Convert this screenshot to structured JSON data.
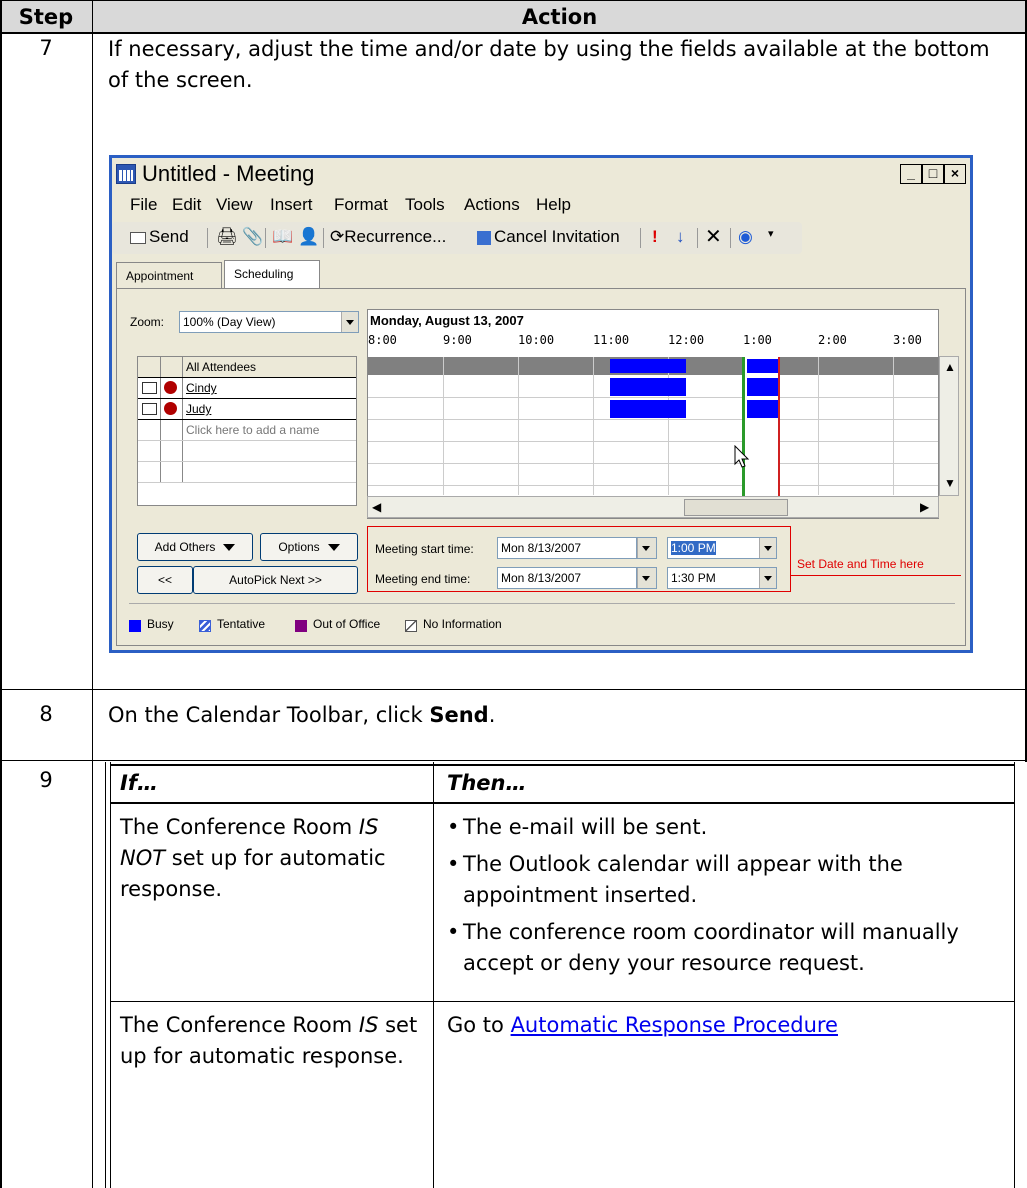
{
  "header": {
    "step": "Step",
    "action": "Action"
  },
  "step7": {
    "number": "7",
    "text": "If necessary, adjust the time and/or date by using the fields available at the bottom of the screen."
  },
  "window": {
    "title": "Untitled - Meeting",
    "controls": [
      "_",
      "□",
      "×"
    ],
    "menu": [
      "File",
      "Edit",
      "View",
      "Insert",
      "Format",
      "Tools",
      "Actions",
      "Help"
    ],
    "toolbar": {
      "send": "Send",
      "recurrence": "Recurrence...",
      "cancel_invitation": "Cancel Invitation"
    },
    "tabs": [
      "Appointment",
      "Scheduling"
    ],
    "zoom_label": "Zoom:",
    "zoom_value": "100% (Day View)",
    "date_heading": "Monday, August 13, 2007",
    "hours": [
      "8:00",
      "9:00",
      "10:00",
      "11:00",
      "12:00",
      "1:00",
      "2:00",
      "3:00"
    ],
    "attendees": {
      "header": "All Attendees",
      "rows": [
        "Cindy",
        "Judy"
      ],
      "add_placeholder": "Click here to add a name"
    },
    "buttons": {
      "add_others": "Add Others",
      "options": "Options",
      "prev": "<<",
      "autopick_next": "AutoPick Next >>"
    },
    "fields": {
      "start_label": "Meeting start time:",
      "start_date": "Mon 8/13/2007",
      "start_time": "1:00 PM",
      "end_label": "Meeting end time:",
      "end_date": "Mon 8/13/2007",
      "end_time": "1:30 PM"
    },
    "annotation": "Set Date and Time here",
    "legend": [
      "Busy",
      "Tentative",
      "Out of Office",
      "No Information"
    ],
    "colors": {
      "busy": "#0000ff",
      "tentative": "#3a5fd8",
      "out_of_office": "#800080",
      "annotation": "#e00000"
    }
  },
  "step8": {
    "number": "8",
    "text_prefix": "On the Calendar Toolbar, click ",
    "text_bold": "Send",
    "text_suffix": "."
  },
  "step9": {
    "number": "9",
    "col_if": "If…",
    "col_then": "Then…",
    "rows": [
      {
        "if_prefix": "The Conference Room ",
        "if_em": "IS NOT",
        "if_suffix": " set up for automatic response.",
        "then_bullets": [
          "The e-mail will be sent.",
          "The Outlook calendar will appear with the appointment inserted.",
          "The conference room coordinator will manually accept or deny your resource request."
        ]
      },
      {
        "if_prefix": "The Conference Room ",
        "if_em": "IS",
        "if_suffix": " set up for automatic response.",
        "then_prefix": "Go to ",
        "then_link": "Automatic Response Procedure"
      }
    ]
  }
}
